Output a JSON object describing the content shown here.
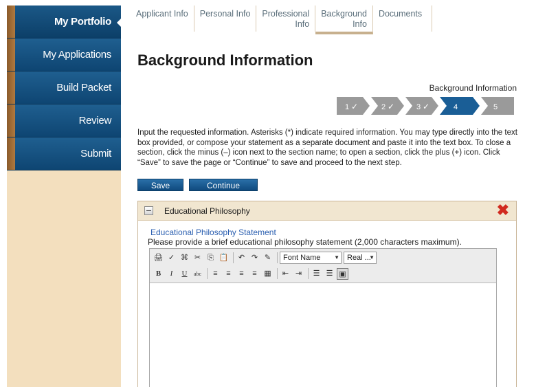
{
  "sidebar": {
    "items": [
      {
        "label": "My Portfolio",
        "active": true
      },
      {
        "label": "My Applications"
      },
      {
        "label": "Build Packet"
      },
      {
        "label": "Review"
      },
      {
        "label": "Submit"
      }
    ]
  },
  "tabs": [
    {
      "line1": "Applicant Info",
      "line2": ""
    },
    {
      "line1": "Personal Info",
      "line2": ""
    },
    {
      "line1": "Professional",
      "line2": "Info"
    },
    {
      "line1": "Background",
      "line2": "Info",
      "active": true
    },
    {
      "line1": "Documents",
      "line2": ""
    }
  ],
  "main": {
    "title": "Background Information",
    "steps_label": "Background Information",
    "steps": [
      {
        "num": "1",
        "done": true
      },
      {
        "num": "2",
        "done": true
      },
      {
        "num": "3",
        "done": true
      },
      {
        "num": "4",
        "current": true
      },
      {
        "num": "5"
      }
    ],
    "instructions": "Input the requested information. Asterisks (*) indicate required information. You may type directly into the text box provided, or compose your statement as a separate document and paste it into the text box. To close a section, click the minus (–) icon next to the section name; to open a section, click the plus (+) icon. Click “Save” to save the page or “Continue” to save and proceed to the next step.",
    "save_label": "Save",
    "continue_label": "Continue"
  },
  "panel": {
    "title": "Educational Philosophy",
    "close_glyph": "✖",
    "field_label": "Educational Philosophy Statement",
    "field_help": "Please provide a brief educational philosophy statement (2,000 characters maximum)."
  },
  "editor": {
    "font_name": "Font Name",
    "font_size": "Real ...",
    "glyphs": {
      "print": "🖨",
      "spell": "✓",
      "find": "⌘",
      "cut": "✂",
      "copy": "⎘",
      "paste": "📋",
      "undo": "↶",
      "redo": "↷",
      "format": "✎",
      "bold": "B",
      "italic": "I",
      "underline": "U",
      "strike": "abc",
      "align_left": "≡",
      "align_center": "≡",
      "align_right": "≡",
      "justify": "≡",
      "table": "▦",
      "outdent": "⇤",
      "indent": "⇥",
      "ordered_list": "☰",
      "unordered_list": "☰",
      "html": "▣"
    }
  },
  "colors": {
    "sidebar_blue": "#0e4572",
    "sidebar_bg": "#f3dfbe",
    "step_done": "#9a9a9a",
    "step_current": "#1a5e96",
    "close_red": "#d12a1f",
    "link_blue": "#2b5fb0"
  }
}
